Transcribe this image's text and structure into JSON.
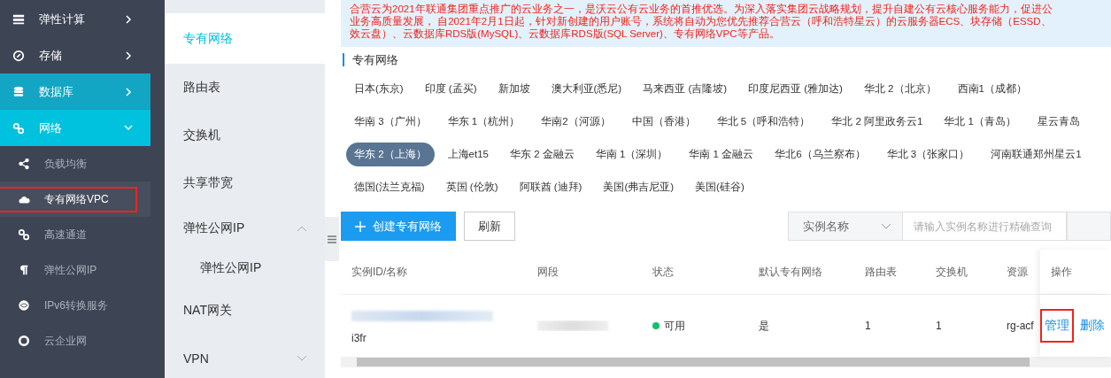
{
  "nav": [
    {
      "label": "弹性计算",
      "kind": "group",
      "expanded": false,
      "hovered": false
    },
    {
      "label": "存储",
      "kind": "group",
      "expanded": false,
      "hovered": false
    },
    {
      "label": "数据库",
      "kind": "group",
      "expanded": false,
      "hovered": true
    },
    {
      "label": "网络",
      "kind": "group",
      "expanded": true,
      "hovered": false
    },
    {
      "label": "负载均衡",
      "kind": "sub",
      "selected": false
    },
    {
      "label": "专有网络VPC",
      "kind": "sub",
      "selected": true
    },
    {
      "label": "高速通道",
      "kind": "sub",
      "selected": false
    },
    {
      "label": "弹性公网IP",
      "kind": "sub",
      "selected": false
    },
    {
      "label": "IPv6转换服务",
      "kind": "sub",
      "selected": false
    },
    {
      "label": "云企业网",
      "kind": "sub",
      "selected": false
    }
  ],
  "subnav": [
    {
      "label": "专有网络",
      "selected": true
    },
    {
      "label": "路由表",
      "selected": false
    },
    {
      "label": "交换机",
      "selected": false
    },
    {
      "label": "共享带宽",
      "selected": false
    },
    {
      "label": "弹性公网IP",
      "selected": false,
      "expanded": true,
      "children": [
        {
          "label": "弹性公网IP",
          "selected": false
        }
      ]
    },
    {
      "label": "NAT网关",
      "selected": false
    },
    {
      "label": "VPN",
      "selected": false,
      "expanded": false
    }
  ],
  "notice": [
    "合营云为2021年联通集团重点推广的云业务之一，是沃云公有云业务的首推优选。为深入落实集团云战略规划，提升自建公有云核心服务能力，促进公",
    "业务高质量发展， 自2021年2月1日起，针对新创建的用户账号，系统将自动为您优先推荐合营云（呼和浩特星云）的云服务器ECS、块存储（ESSD、",
    "效云盘）、云数据库RDS版(MySQL)、云数据库RDS版(SQL Server)、专有网络VPC等产品。"
  ],
  "section_title": "专有网络",
  "regions": [
    [
      {
        "label": "日本(东京)",
        "selected": false
      },
      {
        "label": "印度 (孟买)",
        "selected": false
      },
      {
        "label": "新加坡",
        "selected": false
      },
      {
        "label": "澳大利亚(悉尼)",
        "selected": false
      },
      {
        "label": "马来西亚 (吉隆坡)",
        "selected": false
      },
      {
        "label": "印度尼西亚 (雅加达)",
        "selected": false
      },
      {
        "label": "华北 2（北京）",
        "selected": false
      },
      {
        "label": "西南1（成都）",
        "selected": false
      }
    ],
    [
      {
        "label": "华南 3（广州）",
        "selected": false
      },
      {
        "label": "华东 1（杭州）",
        "selected": false
      },
      {
        "label": "华南2（河源）",
        "selected": false
      },
      {
        "label": "中国（香港）",
        "selected": false
      },
      {
        "label": "华北 5（呼和浩特）",
        "selected": false
      },
      {
        "label": "华北 2 阿里政务云1",
        "selected": false
      },
      {
        "label": "华北 1（青岛）",
        "selected": false
      },
      {
        "label": "星云青岛",
        "selected": false
      }
    ],
    [
      {
        "label": "华东 2（上海）",
        "selected": true
      },
      {
        "label": "上海et15",
        "selected": false
      },
      {
        "label": "华东 2 金融云",
        "selected": false
      },
      {
        "label": "华南 1（深圳）",
        "selected": false
      },
      {
        "label": "华南 1 金融云",
        "selected": false
      },
      {
        "label": "华北6（乌兰察布）",
        "selected": false
      },
      {
        "label": "华北 3（张家口）",
        "selected": false
      },
      {
        "label": "河南联通郑州星云1",
        "selected": false
      }
    ],
    [
      {
        "label": "德国(法兰克福)",
        "selected": false
      },
      {
        "label": "英国 (伦敦)",
        "selected": false
      },
      {
        "label": "阿联酋 (迪拜)",
        "selected": false
      },
      {
        "label": "美国(弗吉尼亚)",
        "selected": false
      },
      {
        "label": "美国(硅谷)",
        "selected": false
      }
    ]
  ],
  "toolbar": {
    "create": "创建专有网络",
    "refresh": "刷新",
    "filter": "实例名称",
    "search_placeholder": "请输入实例名称进行精确查询"
  },
  "table": {
    "columns": [
      "实例ID/名称",
      "网段",
      "状态",
      "默认专有网络",
      "路由表",
      "交换机",
      "资源",
      "操作"
    ],
    "rows": [
      {
        "name": "i3fr",
        "status": "可用",
        "default": "是",
        "route_tables": "1",
        "switches": "1",
        "resource_group": "rg-acf",
        "actions": [
          {
            "label": "管理",
            "highlighted": true
          },
          {
            "label": "删除",
            "highlighted": false
          }
        ]
      }
    ]
  }
}
